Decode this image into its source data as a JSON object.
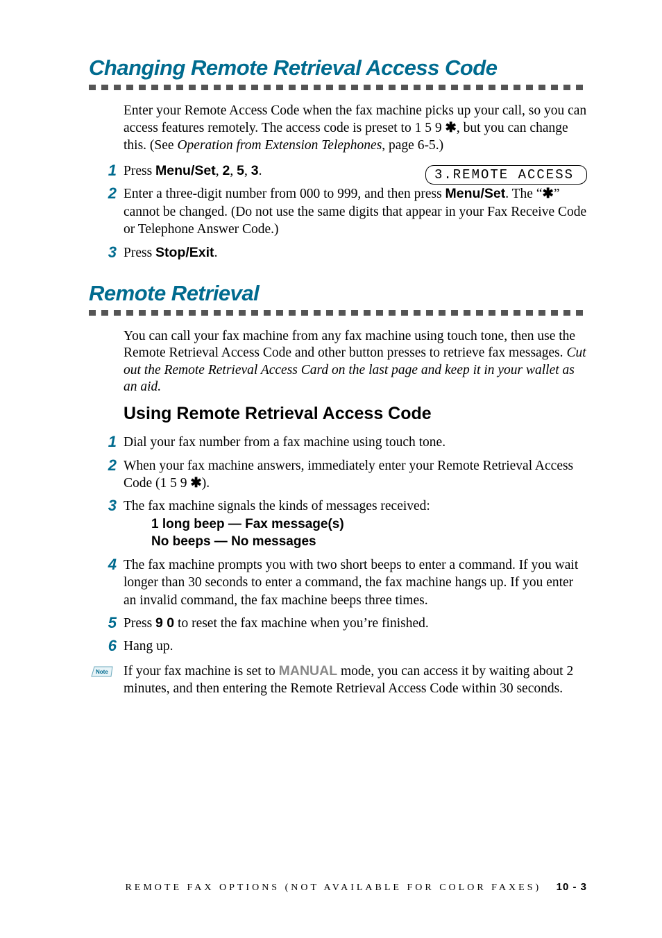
{
  "section1": {
    "title": "Changing Remote Retrieval Access Code",
    "intro_a": "Enter your Remote Access Code when the fax machine picks up your call, so you can access features remotely.  The access code is preset to 1 5 9 ",
    "intro_b": ", but you can change this. (See ",
    "intro_ref": "Operation from Extension Telephones",
    "intro_c": ", page 6-5.)",
    "lcd": "3.REMOTE ACCESS",
    "steps": {
      "s1_a": "Press ",
      "s1_k1": "Menu/Set",
      "s1_b": ", ",
      "s1_k2": "2",
      "s1_c": ", ",
      "s1_k3": "5",
      "s1_d": ", ",
      "s1_k4": "3",
      "s1_e": ".",
      "s2_a": "Enter a three-digit number from 000 to 999, and then press ",
      "s2_k1": "Menu/Set",
      "s2_b": ". The “",
      "s2_c": "” cannot be changed. (Do not use the same digits that appear in your Fax Receive Code or Telephone Answer Code.)",
      "s3_a": "Press ",
      "s3_k1": "Stop/Exit",
      "s3_b": "."
    }
  },
  "section2": {
    "title": "Remote Retrieval",
    "intro_a": "You can call your fax machine from any fax machine using touch tone, then use the Remote Retrieval Access Code and other button presses to retrieve fax messages. ",
    "intro_i": "Cut out the Remote Retrieval Access Card on the last page and keep it in your wallet as an aid.",
    "sub_title": "Using Remote Retrieval Access Code",
    "steps": {
      "s1": "Dial your fax number from a fax machine using touch tone.",
      "s2_a": "When your fax machine answers, immediately enter your Remote Retrieval Access",
      "s2_b": "Code (1 5 9 ",
      "s2_c": ").",
      "s3": "The fax machine signals the kinds of messages received:",
      "s3_b1": "1 long beep — Fax message(s)",
      "s3_b2": "No beeps — No messages",
      "s4": "The fax machine prompts you with two short beeps to enter a command.  If you wait longer than 30 seconds to enter a command, the fax machine hangs up.  If you enter an invalid command, the fax machine beeps three times.",
      "s5_a": "Press ",
      "s5_k1": "9 0",
      "s5_b": " to reset the fax machine when you’re finished.",
      "s6": "Hang up."
    },
    "note_a": "If your fax machine is set to ",
    "note_m": "MANUAL",
    "note_b": " mode, you can access it by waiting about 2 minutes, and then entering the Remote Retrieval Access Code within 30 seconds."
  },
  "footer": {
    "text": "REMOTE FAX OPTIONS (NOT AVAILABLE FOR COLOR FAXES)",
    "page": "10 - 3"
  },
  "star": "✱"
}
